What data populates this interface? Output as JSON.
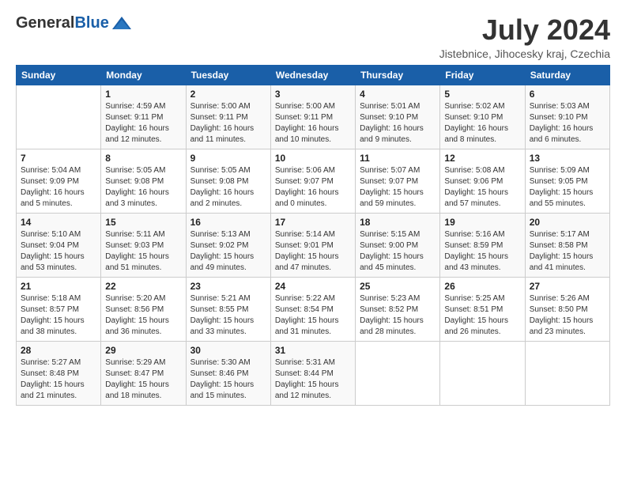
{
  "logo": {
    "general": "General",
    "blue": "Blue"
  },
  "title": "July 2024",
  "location": "Jistebnice, Jihocesky kraj, Czechia",
  "days_of_week": [
    "Sunday",
    "Monday",
    "Tuesday",
    "Wednesday",
    "Thursday",
    "Friday",
    "Saturday"
  ],
  "weeks": [
    [
      {
        "day": "",
        "info": ""
      },
      {
        "day": "1",
        "info": "Sunrise: 4:59 AM\nSunset: 9:11 PM\nDaylight: 16 hours\nand 12 minutes."
      },
      {
        "day": "2",
        "info": "Sunrise: 5:00 AM\nSunset: 9:11 PM\nDaylight: 16 hours\nand 11 minutes."
      },
      {
        "day": "3",
        "info": "Sunrise: 5:00 AM\nSunset: 9:11 PM\nDaylight: 16 hours\nand 10 minutes."
      },
      {
        "day": "4",
        "info": "Sunrise: 5:01 AM\nSunset: 9:10 PM\nDaylight: 16 hours\nand 9 minutes."
      },
      {
        "day": "5",
        "info": "Sunrise: 5:02 AM\nSunset: 9:10 PM\nDaylight: 16 hours\nand 8 minutes."
      },
      {
        "day": "6",
        "info": "Sunrise: 5:03 AM\nSunset: 9:10 PM\nDaylight: 16 hours\nand 6 minutes."
      }
    ],
    [
      {
        "day": "7",
        "info": "Sunrise: 5:04 AM\nSunset: 9:09 PM\nDaylight: 16 hours\nand 5 minutes."
      },
      {
        "day": "8",
        "info": "Sunrise: 5:05 AM\nSunset: 9:08 PM\nDaylight: 16 hours\nand 3 minutes."
      },
      {
        "day": "9",
        "info": "Sunrise: 5:05 AM\nSunset: 9:08 PM\nDaylight: 16 hours\nand 2 minutes."
      },
      {
        "day": "10",
        "info": "Sunrise: 5:06 AM\nSunset: 9:07 PM\nDaylight: 16 hours\nand 0 minutes."
      },
      {
        "day": "11",
        "info": "Sunrise: 5:07 AM\nSunset: 9:07 PM\nDaylight: 15 hours\nand 59 minutes."
      },
      {
        "day": "12",
        "info": "Sunrise: 5:08 AM\nSunset: 9:06 PM\nDaylight: 15 hours\nand 57 minutes."
      },
      {
        "day": "13",
        "info": "Sunrise: 5:09 AM\nSunset: 9:05 PM\nDaylight: 15 hours\nand 55 minutes."
      }
    ],
    [
      {
        "day": "14",
        "info": "Sunrise: 5:10 AM\nSunset: 9:04 PM\nDaylight: 15 hours\nand 53 minutes."
      },
      {
        "day": "15",
        "info": "Sunrise: 5:11 AM\nSunset: 9:03 PM\nDaylight: 15 hours\nand 51 minutes."
      },
      {
        "day": "16",
        "info": "Sunrise: 5:13 AM\nSunset: 9:02 PM\nDaylight: 15 hours\nand 49 minutes."
      },
      {
        "day": "17",
        "info": "Sunrise: 5:14 AM\nSunset: 9:01 PM\nDaylight: 15 hours\nand 47 minutes."
      },
      {
        "day": "18",
        "info": "Sunrise: 5:15 AM\nSunset: 9:00 PM\nDaylight: 15 hours\nand 45 minutes."
      },
      {
        "day": "19",
        "info": "Sunrise: 5:16 AM\nSunset: 8:59 PM\nDaylight: 15 hours\nand 43 minutes."
      },
      {
        "day": "20",
        "info": "Sunrise: 5:17 AM\nSunset: 8:58 PM\nDaylight: 15 hours\nand 41 minutes."
      }
    ],
    [
      {
        "day": "21",
        "info": "Sunrise: 5:18 AM\nSunset: 8:57 PM\nDaylight: 15 hours\nand 38 minutes."
      },
      {
        "day": "22",
        "info": "Sunrise: 5:20 AM\nSunset: 8:56 PM\nDaylight: 15 hours\nand 36 minutes."
      },
      {
        "day": "23",
        "info": "Sunrise: 5:21 AM\nSunset: 8:55 PM\nDaylight: 15 hours\nand 33 minutes."
      },
      {
        "day": "24",
        "info": "Sunrise: 5:22 AM\nSunset: 8:54 PM\nDaylight: 15 hours\nand 31 minutes."
      },
      {
        "day": "25",
        "info": "Sunrise: 5:23 AM\nSunset: 8:52 PM\nDaylight: 15 hours\nand 28 minutes."
      },
      {
        "day": "26",
        "info": "Sunrise: 5:25 AM\nSunset: 8:51 PM\nDaylight: 15 hours\nand 26 minutes."
      },
      {
        "day": "27",
        "info": "Sunrise: 5:26 AM\nSunset: 8:50 PM\nDaylight: 15 hours\nand 23 minutes."
      }
    ],
    [
      {
        "day": "28",
        "info": "Sunrise: 5:27 AM\nSunset: 8:48 PM\nDaylight: 15 hours\nand 21 minutes."
      },
      {
        "day": "29",
        "info": "Sunrise: 5:29 AM\nSunset: 8:47 PM\nDaylight: 15 hours\nand 18 minutes."
      },
      {
        "day": "30",
        "info": "Sunrise: 5:30 AM\nSunset: 8:46 PM\nDaylight: 15 hours\nand 15 minutes."
      },
      {
        "day": "31",
        "info": "Sunrise: 5:31 AM\nSunset: 8:44 PM\nDaylight: 15 hours\nand 12 minutes."
      },
      {
        "day": "",
        "info": ""
      },
      {
        "day": "",
        "info": ""
      },
      {
        "day": "",
        "info": ""
      }
    ]
  ]
}
